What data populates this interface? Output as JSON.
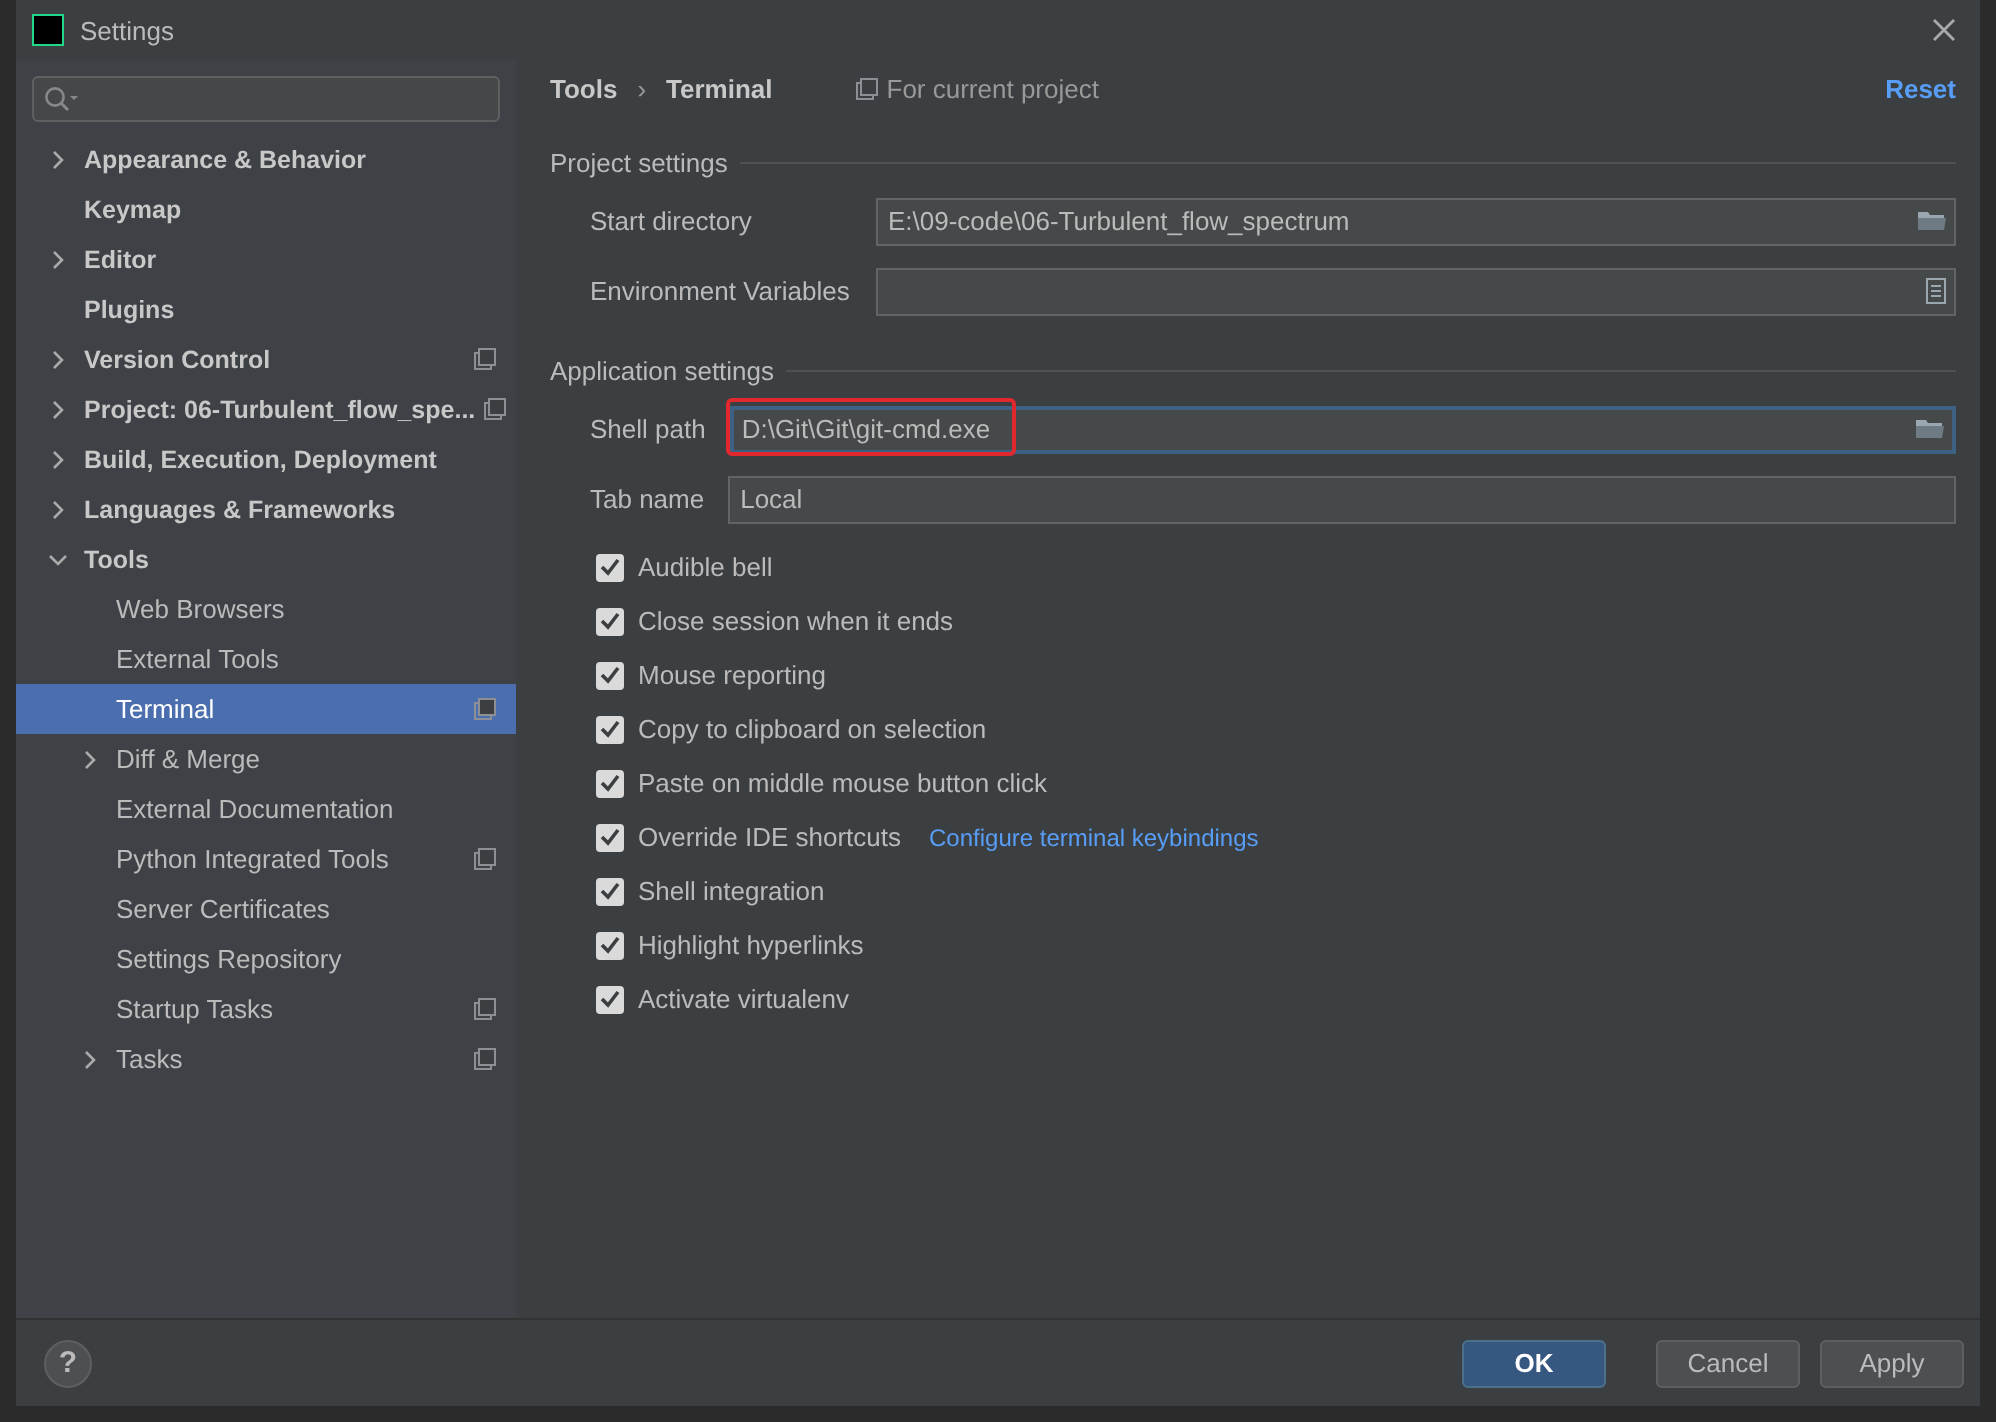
{
  "window": {
    "title": "Settings"
  },
  "sidebar": {
    "items": [
      {
        "label": "Appearance & Behavior",
        "kind": "group",
        "expanded": false,
        "project_scoped": false,
        "selected": false
      },
      {
        "label": "Keymap",
        "kind": "leaf",
        "project_scoped": false,
        "selected": false
      },
      {
        "label": "Editor",
        "kind": "group",
        "expanded": false,
        "project_scoped": false,
        "selected": false
      },
      {
        "label": "Plugins",
        "kind": "leaf",
        "project_scoped": false,
        "selected": false
      },
      {
        "label": "Version Control",
        "kind": "group",
        "expanded": false,
        "project_scoped": true,
        "selected": false
      },
      {
        "label": "Project: 06-Turbulent_flow_spe...",
        "kind": "group",
        "expanded": false,
        "project_scoped": true,
        "selected": false
      },
      {
        "label": "Build, Execution, Deployment",
        "kind": "group",
        "expanded": false,
        "project_scoped": false,
        "selected": false
      },
      {
        "label": "Languages & Frameworks",
        "kind": "group",
        "expanded": false,
        "project_scoped": false,
        "selected": false
      },
      {
        "label": "Tools",
        "kind": "group",
        "expanded": true,
        "project_scoped": false,
        "selected": false,
        "children": [
          {
            "label": "Web Browsers",
            "kind": "leaf",
            "project_scoped": false,
            "selected": false
          },
          {
            "label": "External Tools",
            "kind": "leaf",
            "project_scoped": false,
            "selected": false
          },
          {
            "label": "Terminal",
            "kind": "leaf",
            "project_scoped": true,
            "selected": true
          },
          {
            "label": "Diff & Merge",
            "kind": "group",
            "expanded": false,
            "project_scoped": false,
            "selected": false
          },
          {
            "label": "External Documentation",
            "kind": "leaf",
            "project_scoped": false,
            "selected": false
          },
          {
            "label": "Python Integrated Tools",
            "kind": "leaf",
            "project_scoped": true,
            "selected": false
          },
          {
            "label": "Server Certificates",
            "kind": "leaf",
            "project_scoped": false,
            "selected": false
          },
          {
            "label": "Settings Repository",
            "kind": "leaf",
            "project_scoped": false,
            "selected": false
          },
          {
            "label": "Startup Tasks",
            "kind": "leaf",
            "project_scoped": true,
            "selected": false
          },
          {
            "label": "Tasks",
            "kind": "group",
            "expanded": false,
            "project_scoped": true,
            "selected": false
          }
        ]
      }
    ]
  },
  "header": {
    "breadcrumb": [
      "Tools",
      "Terminal"
    ],
    "separator": "›",
    "scope": "For current project",
    "reset": "Reset"
  },
  "sections": [
    {
      "title": "Project settings",
      "fields": [
        {
          "label": "Start directory",
          "value": "E:\\09-code\\06-Turbulent_flow_spectrum",
          "kind": "folder",
          "focused": false,
          "highlighted": false
        },
        {
          "label": "Environment Variables",
          "kind": "list",
          "focused": false,
          "highlighted": false
        }
      ]
    },
    {
      "title": "Application settings",
      "fields": [
        {
          "label": "Shell path",
          "value": "D:\\Git\\Git\\git-cmd.exe",
          "kind": "folder",
          "focused": true,
          "highlighted": true
        },
        {
          "label": "Tab name",
          "value": "Local",
          "kind": "text",
          "focused": false,
          "highlighted": false
        }
      ]
    }
  ],
  "checkboxes": [
    {
      "label": "Audible bell",
      "checked": true
    },
    {
      "label": "Close session when it ends",
      "checked": true
    },
    {
      "label": "Mouse reporting",
      "checked": true
    },
    {
      "label": "Copy to clipboard on selection",
      "checked": true
    },
    {
      "label": "Paste on middle mouse button click",
      "checked": true
    },
    {
      "label": "Override IDE shortcuts",
      "checked": true,
      "link": "Configure terminal keybindings"
    },
    {
      "label": "Shell integration",
      "checked": true
    },
    {
      "label": "Highlight hyperlinks",
      "checked": true
    },
    {
      "label": "Activate virtualenv",
      "checked": true
    }
  ],
  "footer": {
    "help": "?",
    "buttons": [
      {
        "label": "OK",
        "kind": "default"
      },
      {
        "label": "Cancel",
        "kind": "normal"
      },
      {
        "label": "Apply",
        "kind": "normal"
      }
    ]
  }
}
